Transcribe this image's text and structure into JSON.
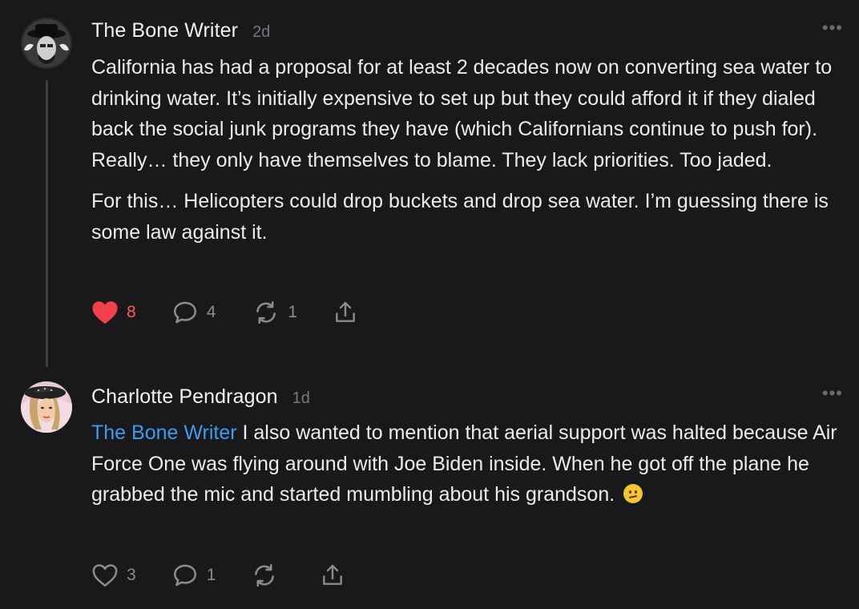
{
  "comments": [
    {
      "author": "The Bone Writer",
      "time": "2d",
      "paragraphs": [
        "California has had a proposal for at least 2 decades now on converting sea water to drinking water. It’s initially expensive to set up but they could afford it if they dialed back the social junk programs they have (which Californians continue to push for). Really… they only have themselves to blame. They lack priorities. Too jaded.",
        "For this… Helicopters could drop buckets and drop sea water. I’m guessing there is some law against it."
      ],
      "likes": "8",
      "liked": true,
      "replies": "4",
      "restacks": "1"
    },
    {
      "author": "Charlotte Pendragon",
      "time": "1d",
      "mention": "The Bone Writer",
      "text": " I also wanted to mention that aerial support was halted because Air Force One was flying around with Joe Biden inside. When he got off the plane he grabbed the mic and started mumbling about his grandson.",
      "emoji": "confused-face-emoji",
      "likes": "3",
      "liked": false,
      "replies": "1",
      "restacks": ""
    }
  ],
  "more_label": "•••",
  "colors": {
    "background": "#19191b",
    "like_active": "#ff5a5a",
    "mention": "#3d9bf2"
  }
}
